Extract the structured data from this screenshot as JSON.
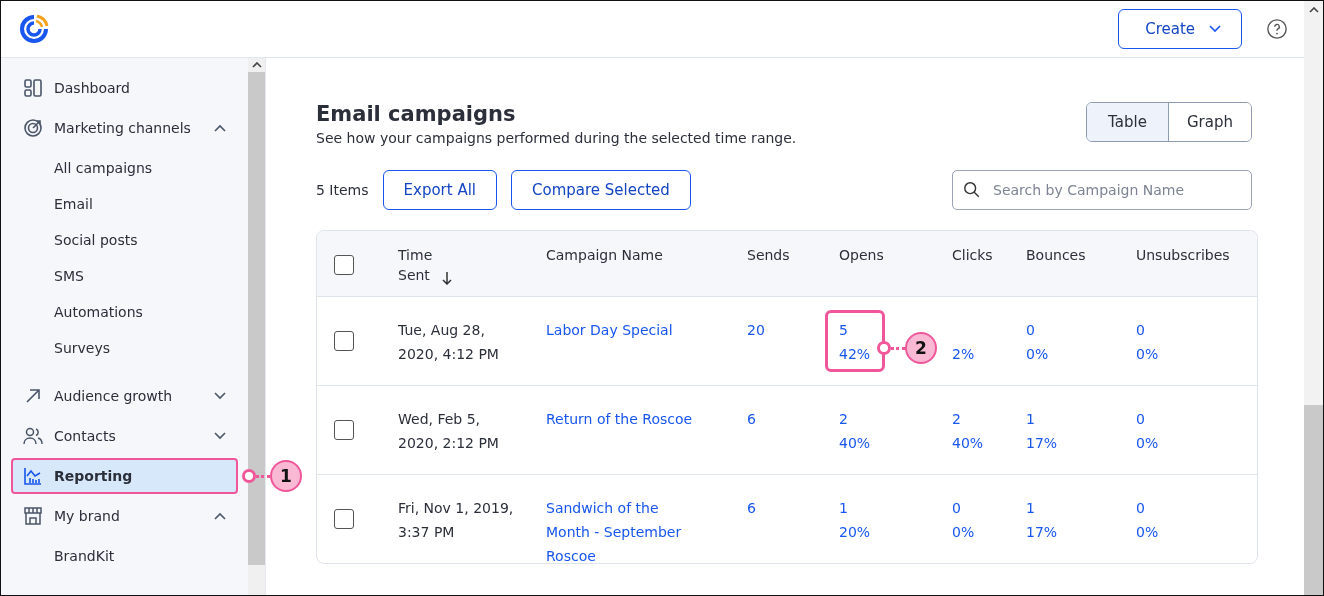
{
  "header": {
    "create_button": "Create"
  },
  "sidebar": {
    "items": [
      {
        "label": "Dashboard",
        "selected": false
      },
      {
        "label": "Marketing channels",
        "expanded": true,
        "selected": false,
        "children": [
          {
            "label": "All campaigns"
          },
          {
            "label": "Email"
          },
          {
            "label": "Social posts"
          },
          {
            "label": "SMS"
          },
          {
            "label": "Automations"
          },
          {
            "label": "Surveys"
          }
        ]
      },
      {
        "label": "Audience growth",
        "expanded": false,
        "selected": false
      },
      {
        "label": "Contacts",
        "expanded": false,
        "selected": false
      },
      {
        "label": "Reporting",
        "selected": true,
        "callout": "1"
      },
      {
        "label": "My brand",
        "expanded": true,
        "selected": false,
        "children": [
          {
            "label": "BrandKit"
          }
        ]
      }
    ]
  },
  "main": {
    "title": "Email campaigns",
    "subtitle": "See how your campaigns performed during the selected time range.",
    "view_tabs": [
      {
        "label": "Table",
        "selected": true
      },
      {
        "label": "Graph",
        "selected": false
      }
    ],
    "item_count": "5 Items",
    "buttons": [
      "Export All",
      "Compare Selected"
    ],
    "search": {
      "placeholder": "Search by Campaign Name"
    },
    "table": {
      "select_all_checked": false,
      "columns": [
        "Time Sent",
        "Campaign Name",
        "Sends",
        "Opens",
        "Clicks",
        "Bounces",
        "Unsubscribes"
      ],
      "rows": [
        {
          "checked": false,
          "time": "Tue, Aug 28, 2020, 4:12 PM",
          "name": "Labor Day Special",
          "sends": "20",
          "opens": [
            "5",
            "42%"
          ],
          "opens_callout": "2",
          "clicks": [
            "2%"
          ],
          "bounces": [
            "0",
            "0%"
          ],
          "unsubscribes": [
            "0",
            "0%"
          ]
        },
        {
          "checked": false,
          "time": "Wed, Feb 5, 2020, 2:12 PM",
          "name": "Return of the Roscoe",
          "sends": "6",
          "opens": [
            "2",
            "40%"
          ],
          "clicks": [
            "2",
            "40%"
          ],
          "bounces": [
            "1",
            "17%"
          ],
          "unsubscribes": [
            "0",
            "0%"
          ]
        },
        {
          "checked": false,
          "time": "Fri, Nov 1, 2019, 3:37 PM",
          "name": "Sandwich of the Month - September Roscoe",
          "sends": "6",
          "opens": [
            "1",
            "20%"
          ],
          "clicks": [
            "0",
            "0%"
          ],
          "bounces": [
            "1",
            "17%"
          ],
          "unsubscribes": [
            "0",
            "0%"
          ]
        }
      ]
    }
  }
}
